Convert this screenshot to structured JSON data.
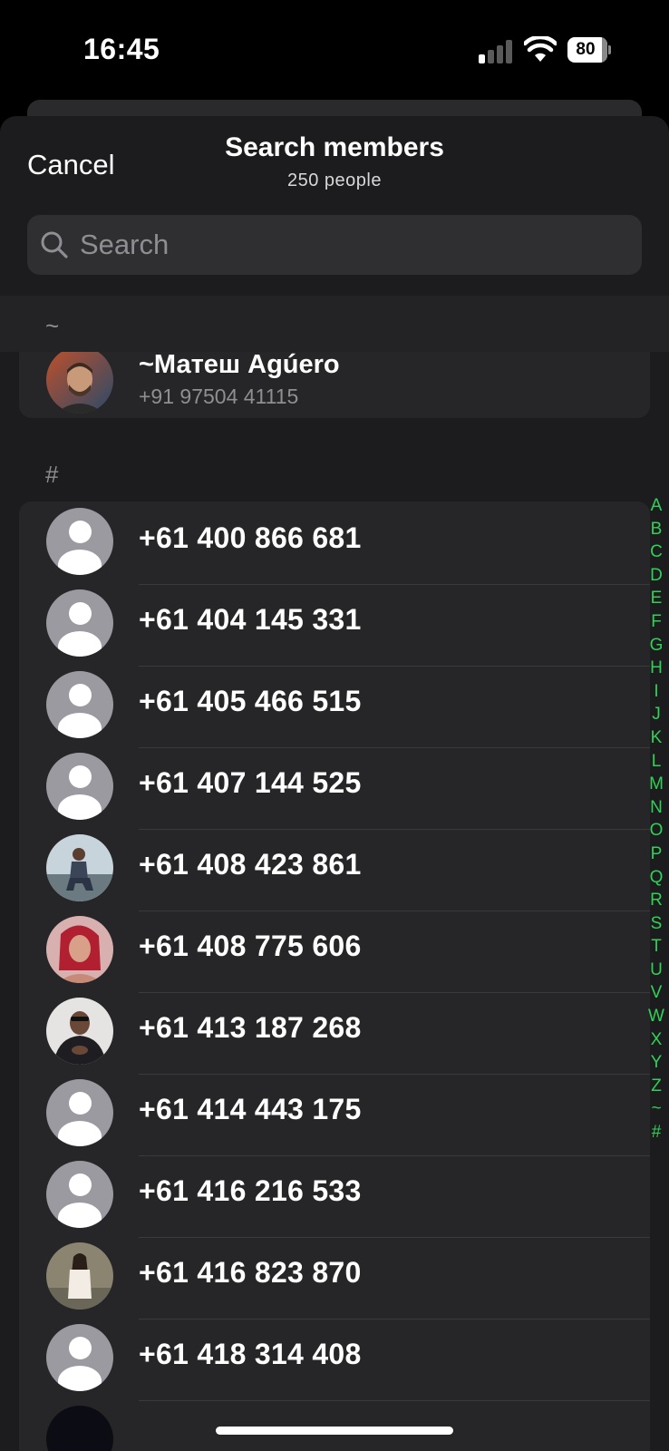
{
  "status_bar": {
    "time": "16:45",
    "battery": "80"
  },
  "header": {
    "cancel": "Cancel",
    "title": "Search members",
    "subtitle": "250 people"
  },
  "search": {
    "placeholder": "Search"
  },
  "sections": {
    "tilde": "~",
    "hash": "#"
  },
  "featured_member": {
    "name": "~Матеш Agúero",
    "phone": "+91 97504 41115"
  },
  "members": [
    {
      "phone": "+61 400 866 681",
      "avatar": "placeholder"
    },
    {
      "phone": "+61 404 145 331",
      "avatar": "placeholder"
    },
    {
      "phone": "+61 405 466 515",
      "avatar": "placeholder"
    },
    {
      "phone": "+61 407 144 525",
      "avatar": "placeholder"
    },
    {
      "phone": "+61 408 423 861",
      "avatar": "photo-man-sitting"
    },
    {
      "phone": "+61 408 775 606",
      "avatar": "photo-woman-red-hair"
    },
    {
      "phone": "+61 413 187 268",
      "avatar": "photo-man-dark-jacket"
    },
    {
      "phone": "+61 414 443 175",
      "avatar": "placeholder"
    },
    {
      "phone": "+61 416 216 533",
      "avatar": "placeholder"
    },
    {
      "phone": "+61 416 823 870",
      "avatar": "photo-woman-outdoor"
    },
    {
      "phone": "+61 418 314 408",
      "avatar": "placeholder"
    }
  ],
  "index_letters": [
    "A",
    "B",
    "C",
    "D",
    "E",
    "F",
    "G",
    "H",
    "I",
    "J",
    "K",
    "L",
    "M",
    "N",
    "O",
    "P",
    "Q",
    "R",
    "S",
    "T",
    "U",
    "V",
    "W",
    "X",
    "Y",
    "Z",
    "~",
    "#"
  ],
  "colors": {
    "accent": "#30d158",
    "background": "#1c1c1e",
    "row": "#262628",
    "secondary_text": "#8e8e93"
  }
}
